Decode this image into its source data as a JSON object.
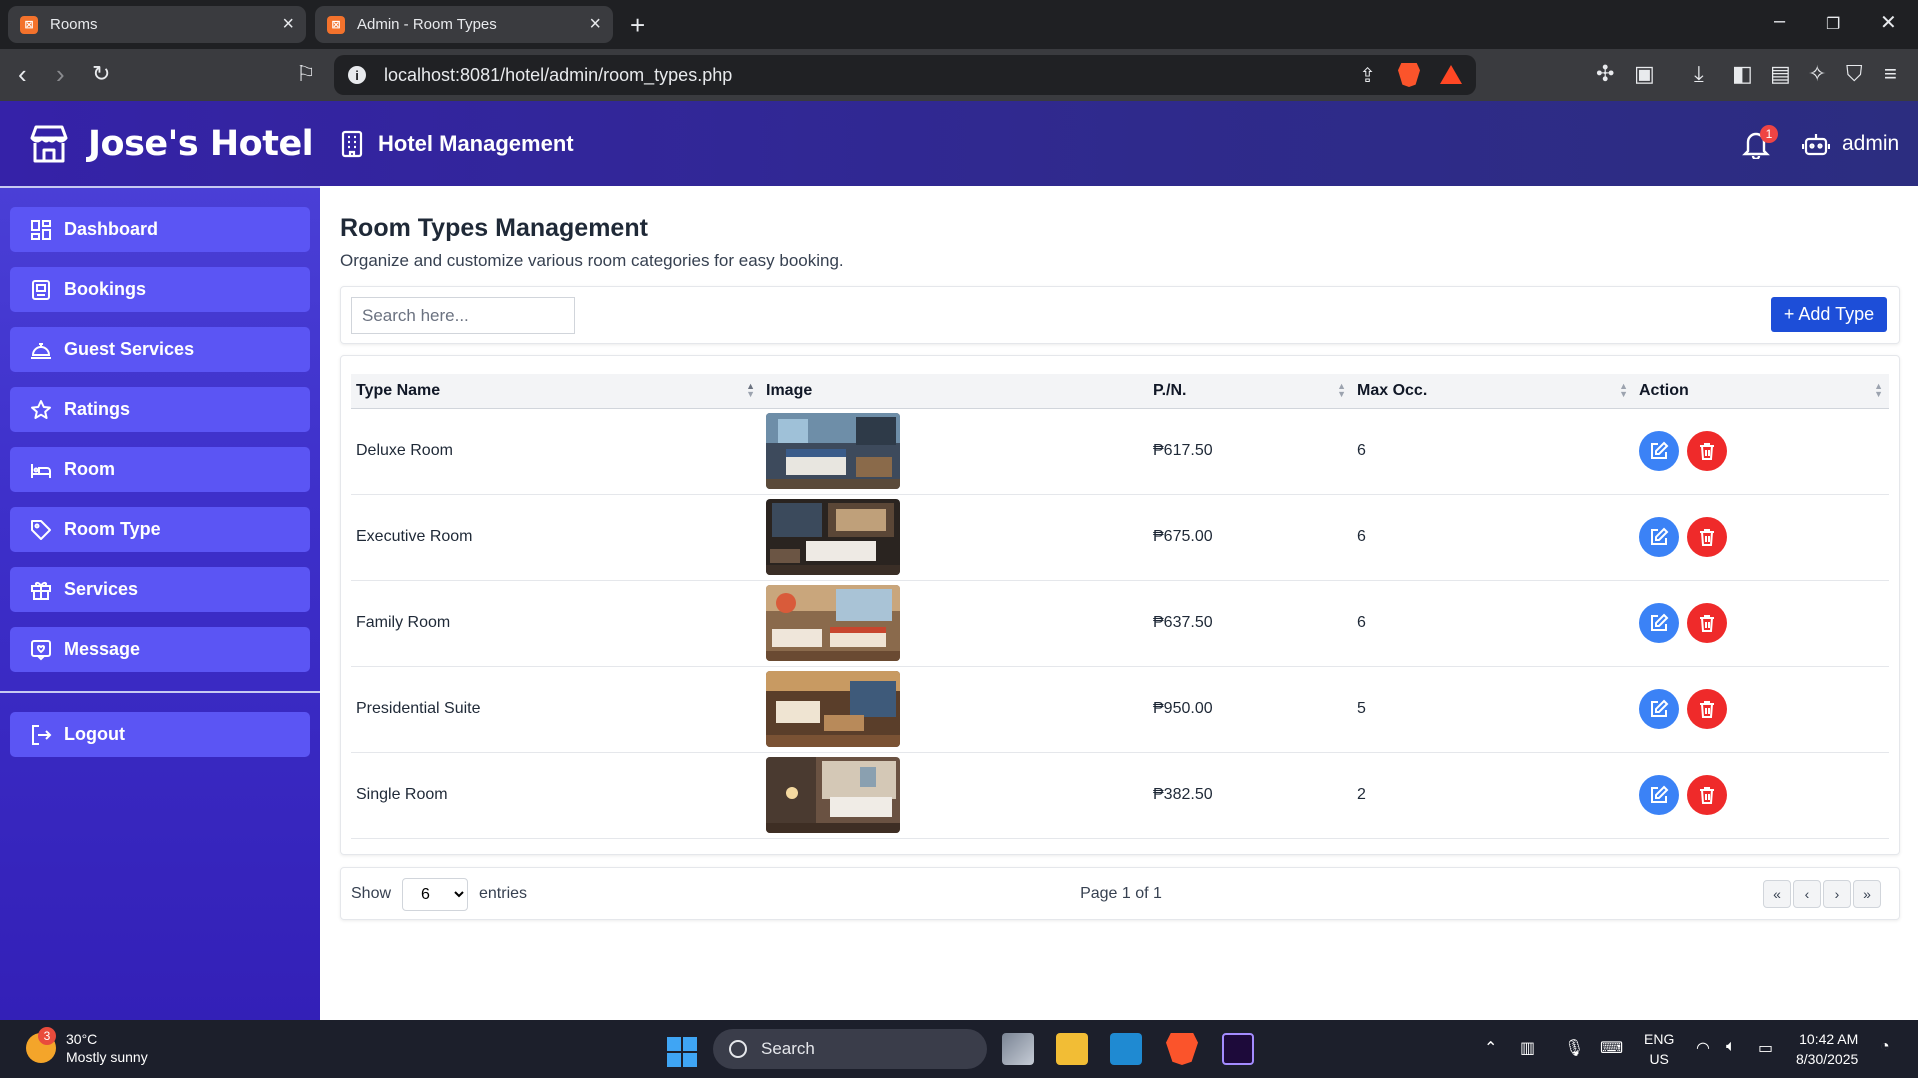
{
  "browser": {
    "tabs": [
      {
        "title": "Rooms",
        "favicon": "xampp-icon"
      },
      {
        "title": "Admin - Room Types",
        "favicon": "xampp-icon"
      }
    ],
    "url": "localhost:8081/hotel/admin/room_types.php"
  },
  "app": {
    "brand": "Jose's Hotel",
    "header_title": "Hotel Management",
    "notification_count": "1",
    "user": "admin"
  },
  "sidebar": {
    "items": [
      {
        "label": "Dashboard",
        "icon": "dashboard-icon"
      },
      {
        "label": "Bookings",
        "icon": "bookings-icon"
      },
      {
        "label": "Guest Services",
        "icon": "bell-service-icon"
      },
      {
        "label": "Ratings",
        "icon": "star-icon"
      },
      {
        "label": "Room",
        "icon": "bed-icon"
      },
      {
        "label": "Room Type",
        "icon": "tag-icon"
      },
      {
        "label": "Services",
        "icon": "gift-icon"
      },
      {
        "label": "Message",
        "icon": "message-icon"
      }
    ],
    "logout": "Logout"
  },
  "page": {
    "title": "Room Types Management",
    "subtitle": "Organize and customize various room categories for easy booking.",
    "search_placeholder": "Search here...",
    "add_button": "+ Add Type"
  },
  "table": {
    "columns": [
      "Type Name",
      "Image",
      "P./N.",
      "Max Occ.",
      "Action"
    ],
    "rows": [
      {
        "name": "Deluxe Room",
        "price": "₱617.50",
        "max": "6"
      },
      {
        "name": "Executive Room",
        "price": "₱675.00",
        "max": "6"
      },
      {
        "name": "Family Room",
        "price": "₱637.50",
        "max": "6"
      },
      {
        "name": "Presidential Suite",
        "price": "₱950.00",
        "max": "5"
      },
      {
        "name": "Single Room",
        "price": "₱382.50",
        "max": "2"
      }
    ]
  },
  "pagination": {
    "show_label": "Show",
    "entries_value": "6",
    "entries_label": "entries",
    "page_info": "Page 1 of 1",
    "first": "«",
    "prev": "‹",
    "next": "›",
    "last": "»"
  },
  "taskbar": {
    "weather_temp": "30°C",
    "weather_desc": "Mostly sunny",
    "weather_badge": "3",
    "search_label": "Search",
    "lang_top": "ENG",
    "lang_bottom": "US",
    "time": "10:42 AM",
    "date": "8/30/2025"
  },
  "colors": {
    "header": "#2f2a8c",
    "sidebar": "#3d2fc9",
    "nav_item": "#5b55f4",
    "add_button": "#1d4ed8",
    "edit_button": "#3b82f6",
    "delete_button": "#ef2a2a"
  }
}
